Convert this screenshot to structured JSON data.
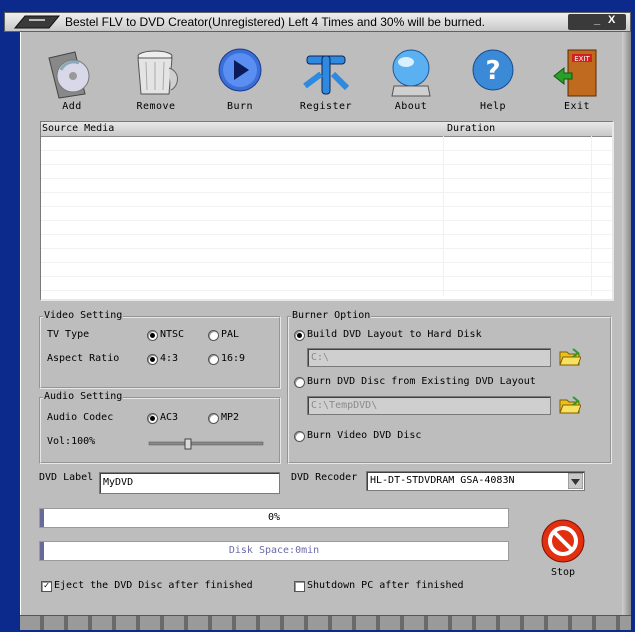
{
  "window": {
    "title": "Bestel FLV to DVD Creator(Unregistered) Left 4 Times and 30% will be burned.",
    "min_label": "_",
    "close_label": "X"
  },
  "toolbar": [
    {
      "label": "Add",
      "icon": "add-disc-icon"
    },
    {
      "label": "Remove",
      "icon": "trash-icon"
    },
    {
      "label": "Burn",
      "icon": "play-icon"
    },
    {
      "label": "Register",
      "icon": "register-icon"
    },
    {
      "label": "About",
      "icon": "about-globe-icon"
    },
    {
      "label": "Help",
      "icon": "help-icon"
    },
    {
      "label": "Exit",
      "icon": "exit-door-icon"
    }
  ],
  "media": {
    "col_source": "Source Media",
    "col_duration": "Duration",
    "rows": []
  },
  "video": {
    "title": "Video Setting",
    "tv_type_label": "TV Type",
    "ntsc": "NTSC",
    "pal": "PAL",
    "aspect_label": "Aspect Ratio",
    "a43": "4:3",
    "a169": "16:9",
    "tv_selected": "NTSC",
    "aspect_selected": "4:3"
  },
  "audio": {
    "title": "Audio Setting",
    "codec_label": "Audio Codec",
    "ac3": "AC3",
    "mp2": "MP2",
    "vol_label": "Vol:100%",
    "codec_selected": "AC3",
    "volume_percent": 100
  },
  "burner": {
    "title": "Burner Option",
    "opt1": "Build DVD Layout to Hard Disk",
    "path1": "C:\\",
    "opt2": "Burn DVD Disc from Existing DVD Layout",
    "path2": "C:\\TempDVD\\",
    "opt3": "Burn Video DVD Disc",
    "selected": "Build DVD Layout to Hard Disk"
  },
  "dvd": {
    "label_caption": "DVD Label",
    "label_value": "MyDVD",
    "recorder_caption": "DVD Recoder",
    "recorder_value": "HL-DT-STDVDRAM GSA-4083N"
  },
  "progress": {
    "text": "0%",
    "value": 0
  },
  "disk": {
    "text": "Disk Space:0min"
  },
  "stop_label": "Stop",
  "options": {
    "eject_label": "Eject the DVD Disc after finished",
    "eject_checked": true,
    "shutdown_label": "Shutdown PC after finished",
    "shutdown_checked": false
  }
}
